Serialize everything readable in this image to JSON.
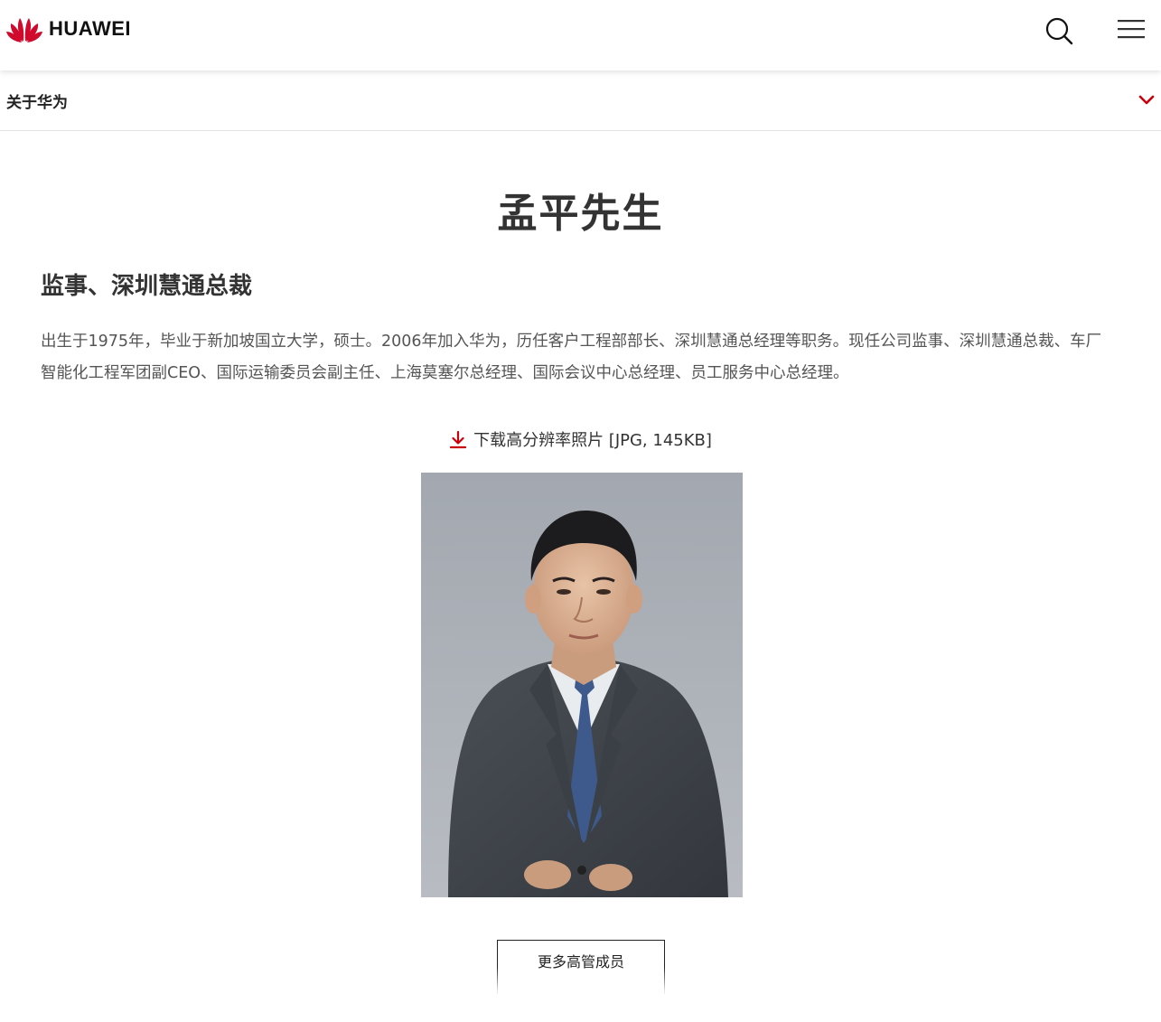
{
  "header": {
    "brand": "HUAWEI",
    "logo_icon": "huawei-petal-logo",
    "brand_color": "#cf0a2c",
    "search_icon": "search-icon",
    "menu_icon": "hamburger-menu-icon"
  },
  "subnav": {
    "label": "关于华为",
    "chevron_icon": "chevron-down-icon",
    "accent": "#c7000b"
  },
  "profile": {
    "name": "孟平先生",
    "position": "监事、深圳慧通总裁",
    "bio": "出生于1975年，毕业于新加坡国立大学，硕士。2006年加入华为，历任客户工程部部长、深圳慧通总经理等职务。现任公司监事、深圳慧通总裁、车厂智能化工程军团副CEO、国际运输委员会副主任、上海莫塞尔总经理、国际会议中心总经理、员工服务中心总经理。",
    "download_label": "下载高分辨率照片 [JPG, 145KB]",
    "download_icon": "download-icon",
    "photo_desc_icon": "portrait-photo"
  },
  "footer": {
    "more_button": "更多高管成员"
  }
}
